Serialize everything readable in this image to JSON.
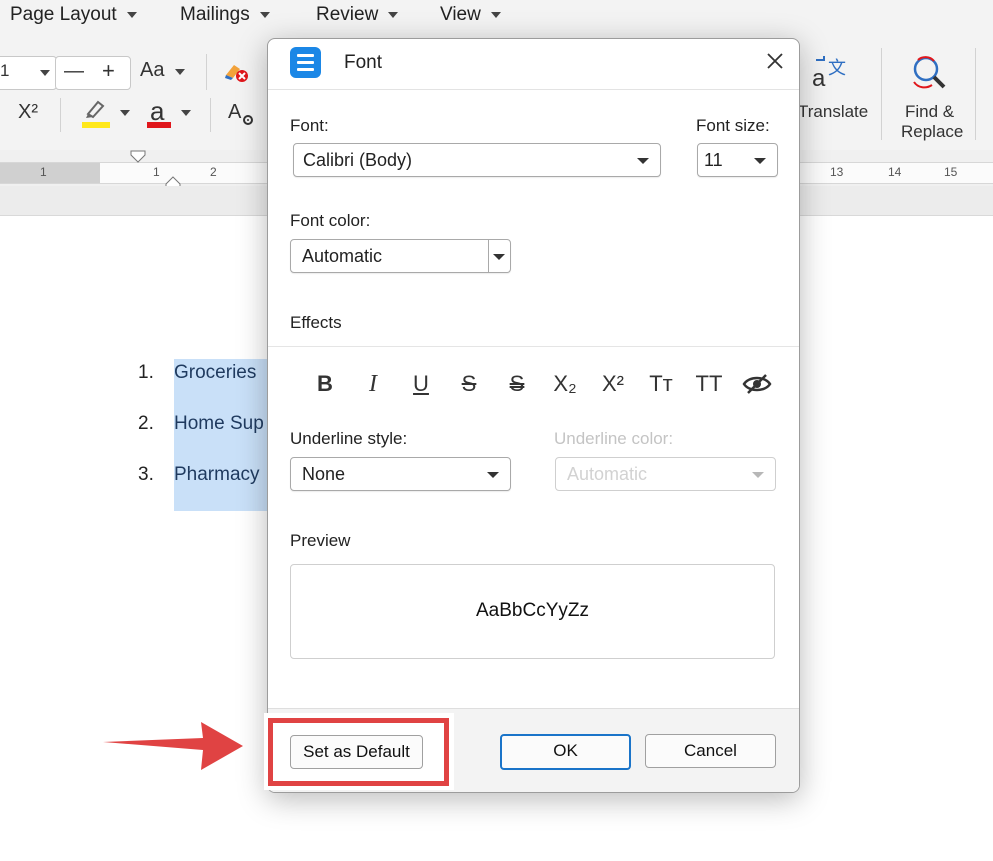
{
  "menu": {
    "items": [
      "Page Layout",
      "Mailings",
      "Review",
      "View"
    ]
  },
  "ribbon": {
    "font_size_partial": "1",
    "minus": "—",
    "plus": "+",
    "change_case": "Aa",
    "superscript": "X²",
    "font_color_letter": "a",
    "translate_label": "Translate",
    "find_replace_label_1": "Find &",
    "find_replace_label_2": "Replace",
    "highlight_color": "#ffe81a",
    "font_color": "#e0161b"
  },
  "ruler": {
    "numbers": [
      "1",
      "1",
      "2",
      "13",
      "14",
      "15"
    ]
  },
  "document": {
    "list": [
      {
        "num": "1.",
        "text": "Groceries"
      },
      {
        "num": "2.",
        "text": "Home Sup"
      },
      {
        "num": "3.",
        "text": "Pharmacy"
      }
    ],
    "highlight_color": "#c9e0f8"
  },
  "dialog": {
    "title": "Font",
    "font_label": "Font:",
    "font_value": "Calibri (Body)",
    "size_label": "Font size:",
    "size_value": "11",
    "color_label": "Font color:",
    "color_value": "Automatic",
    "effects_label": "Effects",
    "effects": [
      "B",
      "I",
      "U",
      "S",
      "S",
      "X₂",
      "X²",
      "Tт",
      "TT"
    ],
    "underline_style_label": "Underline style:",
    "underline_style_value": "None",
    "underline_color_label": "Underline color:",
    "underline_color_value": "Automatic",
    "preview_label": "Preview",
    "preview_text": "AaBbCcYyZz",
    "set_default": "Set as Default",
    "ok": "OK",
    "cancel": "Cancel",
    "icon_color": "#1b87e6",
    "ok_border_color": "#1a74c9"
  },
  "annotation": {
    "color": "#e04343"
  }
}
